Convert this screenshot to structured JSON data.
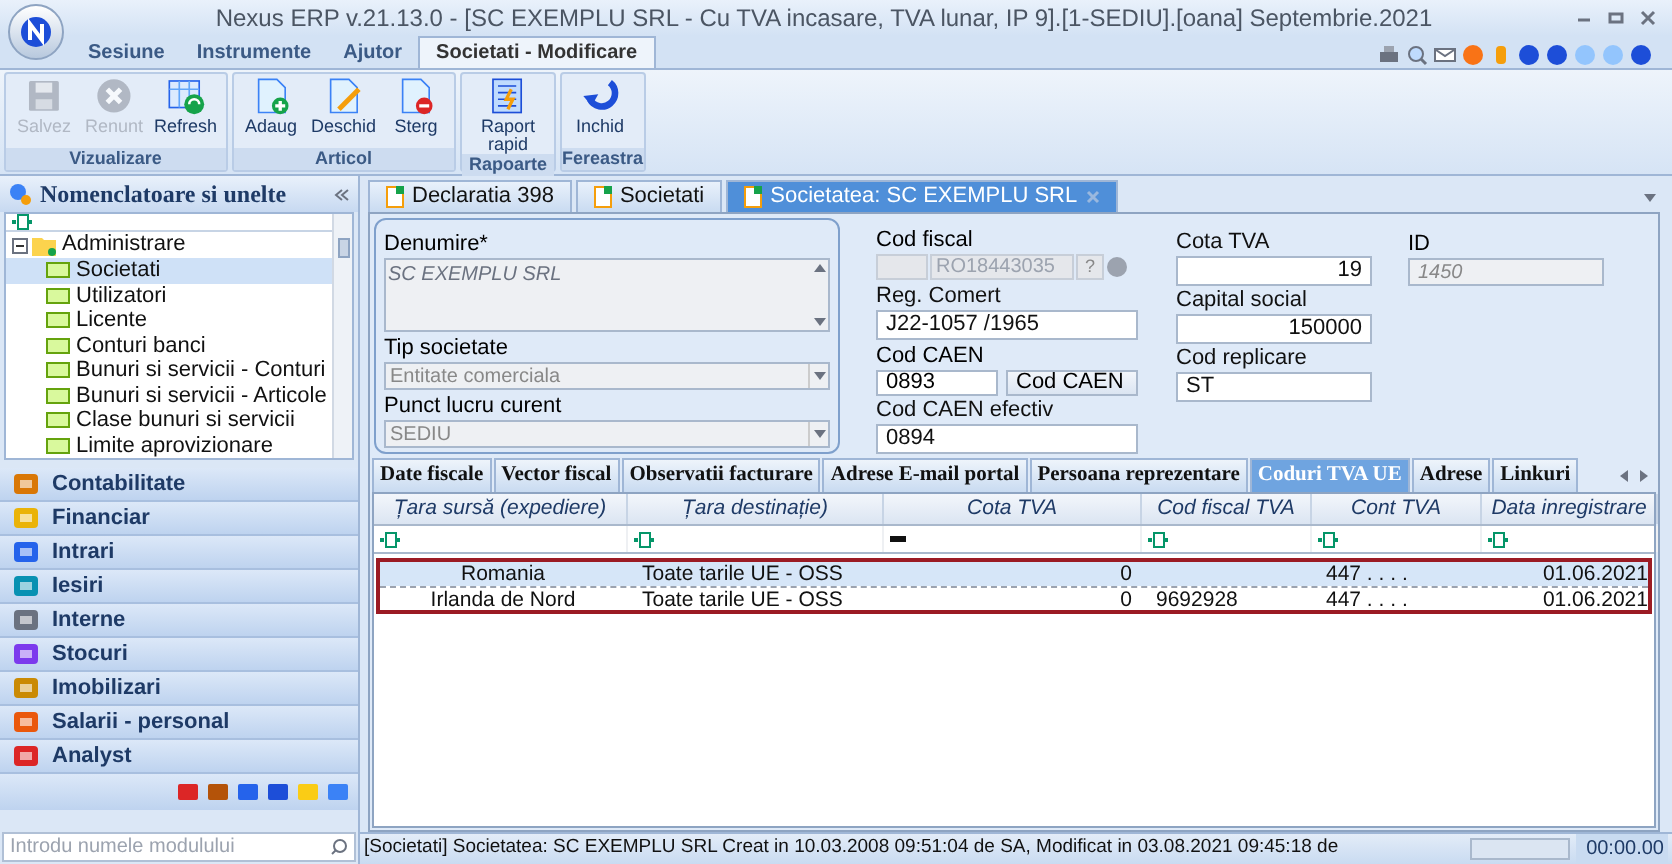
{
  "window": {
    "title": "Nexus ERP v.21.13.0 - [SC EXEMPLU SRL - Cu TVA incasare, TVA lunar, IP 9].[1-SEDIU].[oana] Septembrie.2021"
  },
  "ribbon_tabs": [
    {
      "label": "Sesiune",
      "selected": false
    },
    {
      "label": "Instrumente",
      "selected": false
    },
    {
      "label": "Ajutor",
      "selected": false
    },
    {
      "label": "Societati - Modificare",
      "selected": true
    }
  ],
  "ribbon_groups": [
    {
      "label": "Vizualizare",
      "buttons": [
        {
          "label": "Salvez",
          "kind": "save",
          "disabled": true
        },
        {
          "label": "Renunt",
          "kind": "cancel",
          "disabled": true
        },
        {
          "label": "Refresh",
          "kind": "refresh",
          "disabled": false
        }
      ]
    },
    {
      "label": "Articol",
      "buttons": [
        {
          "label": "Adaug",
          "kind": "add",
          "disabled": false
        },
        {
          "label": "Deschid",
          "kind": "edit",
          "disabled": false
        },
        {
          "label": "Sterg",
          "kind": "delete",
          "disabled": false
        }
      ]
    },
    {
      "label": "Rapoarte",
      "buttons": [
        {
          "label": "Raport rapid",
          "kind": "report",
          "disabled": false
        }
      ]
    },
    {
      "label": "Fereastra",
      "buttons": [
        {
          "label": "Inchid",
          "kind": "close",
          "disabled": false
        }
      ]
    }
  ],
  "sidebar": {
    "title": "Nomenclatoare si unelte",
    "tree": [
      {
        "label": "Administrare",
        "expanded": true,
        "children": [
          {
            "label": "Societati",
            "selected": true
          },
          {
            "label": "Utilizatori",
            "selected": false
          },
          {
            "label": "Licente",
            "selected": false
          },
          {
            "label": "Conturi banci",
            "selected": false
          },
          {
            "label": "Bunuri si servicii - Conturi",
            "selected": false
          },
          {
            "label": "Bunuri si servicii - Articole",
            "selected": false
          },
          {
            "label": "Clase bunuri si servicii",
            "selected": false
          },
          {
            "label": "Limite aprovizionare",
            "selected": false
          }
        ]
      }
    ],
    "sections": [
      {
        "label": "Contabilitate",
        "kind": "scale"
      },
      {
        "label": "Financiar",
        "kind": "money"
      },
      {
        "label": "Intrari",
        "kind": "in"
      },
      {
        "label": "Iesiri",
        "kind": "out"
      },
      {
        "label": "Interne",
        "kind": "clip"
      },
      {
        "label": "Stocuri",
        "kind": "grid"
      },
      {
        "label": "Imobilizari",
        "kind": "build"
      },
      {
        "label": "Salarii - personal",
        "kind": "person"
      },
      {
        "label": "Analyst",
        "kind": "chart"
      }
    ],
    "module_search": {
      "placeholder": "Introdu numele modulului"
    }
  },
  "doc_tabs": [
    {
      "label": "Declaratia 398",
      "selected": false,
      "closable": false
    },
    {
      "label": "Societati",
      "selected": false,
      "closable": false
    },
    {
      "label": "Societatea: SC EXEMPLU SRL",
      "selected": true,
      "closable": true
    }
  ],
  "form": {
    "denumire": {
      "label": "Denumire*",
      "value": "SC EXEMPLU SRL"
    },
    "tip_societate": {
      "label": "Tip societate",
      "value": "Entitate comerciala",
      "disabled": true
    },
    "punct_lucru": {
      "label": "Punct lucru curent",
      "value": "SEDIU",
      "disabled": true
    },
    "cod_fiscal": {
      "label": "Cod fiscal",
      "value": "RO18443035",
      "disabled": true,
      "help": "?"
    },
    "reg_comert": {
      "label": "Reg. Comert",
      "value": "J22-1057 /1965"
    },
    "cod_caen": {
      "label": "Cod CAEN",
      "value": "0893",
      "button": "Cod CAEN"
    },
    "cod_caen_efectiv": {
      "label": "Cod CAEN efectiv",
      "value": "0894"
    },
    "cota_tva": {
      "label": "Cota TVA",
      "value": "19"
    },
    "capital_social": {
      "label": "Capital social",
      "value": "150000"
    },
    "cod_replicare": {
      "label": "Cod replicare",
      "value": "ST"
    },
    "id": {
      "label": "ID",
      "value": "1450",
      "disabled": true
    }
  },
  "sub_tabs": [
    {
      "label": "Date fiscale",
      "selected": false
    },
    {
      "label": "Vector fiscal",
      "selected": false
    },
    {
      "label": "Observatii facturare",
      "selected": false
    },
    {
      "label": "Adrese E-mail portal",
      "selected": false
    },
    {
      "label": "Persoana reprezentare",
      "selected": false
    },
    {
      "label": "Coduri TVA UE",
      "selected": true
    },
    {
      "label": "Adrese",
      "selected": false
    },
    {
      "label": "Linkuri",
      "selected": false
    }
  ],
  "table": {
    "columns": [
      {
        "label": "Țara sursă (expediere)",
        "kind": "filter"
      },
      {
        "label": "Țara destinație)",
        "kind": "filter"
      },
      {
        "label": "Cota TVA",
        "kind": "dash"
      },
      {
        "label": "Cod fiscal TVA",
        "kind": "filter"
      },
      {
        "label": "Cont TVA",
        "kind": "filter"
      },
      {
        "label": "Data inregistrare",
        "kind": "filter"
      }
    ],
    "rows": [
      {
        "selected": true,
        "cells": [
          "Romania",
          "Toate tarile UE - OSS",
          "0",
          "",
          "447 . . . .",
          "01.06.2021"
        ]
      },
      {
        "selected": false,
        "cells": [
          "Irlanda de Nord",
          "Toate tarile UE - OSS",
          "0",
          "9692928",
          "447 . . . .",
          "01.06.2021"
        ]
      }
    ]
  },
  "status_bar": {
    "text": "[Societati] Societatea: SC EXEMPLU SRL Creat in 10.03.2008 09:51:04 de SA,  Modificat in 03.08.2021 09:45:18 de",
    "time": "00:00.00"
  }
}
